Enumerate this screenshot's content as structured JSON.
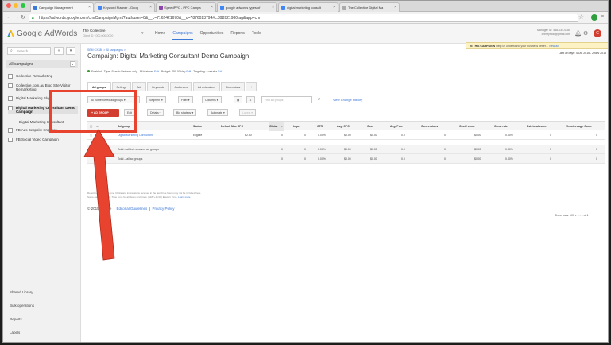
{
  "browser": {
    "tabs": [
      {
        "label": "Campaign Management",
        "color": "#3c78d8"
      },
      {
        "label": "Keyword Planner - Goog",
        "color": "#4285f4"
      },
      {
        "label": "SpeedPPC - PPC Campa",
        "color": "#8e44ad"
      },
      {
        "label": "google adwords types of",
        "color": "#4285f4"
      },
      {
        "label": "digital marketing consult",
        "color": "#4285f4"
      },
      {
        "label": "The Collective Digital Ma",
        "color": "#aaaaaa"
      }
    ],
    "url": "https://adwords.google.com/cm/CampaignMgmt?authuser=0&__c=7162421670&__u=7876023794#c.398921980.ag&app=cm"
  },
  "header": {
    "logo_google": "Google",
    "logo_adwords": "AdWords",
    "account_name": "The Collective",
    "account_id": "Client ID · 000-000-0000",
    "nav": [
      "Home",
      "Campaigns",
      "Opportunities",
      "Reports",
      "Tools"
    ],
    "active_nav": "Campaigns",
    "manager_line1": "Manager ID: 448-034-0380",
    "manager_line2": "chrisfymoo@gmail.com",
    "avatar_letter": "C"
  },
  "sidebar": {
    "search_placeholder": "Search",
    "all_campaigns": "All campaigns",
    "campaigns": [
      "Collective Remarketing",
      "Collective.com.au Blog Site Visitor Remarketing",
      "Digital Marketing Blog",
      "Digital Marketing Consultant Demo Campaign",
      "Digital Marketing Consultant",
      "FB Ads Bespoke Enquirer",
      "FB Social Video Campaign"
    ],
    "bottom_links": [
      "Shared Library",
      "Bulk operations",
      "Reports",
      "Labels"
    ]
  },
  "main": {
    "breadcrumb": "SEM CX380 > All campaigns >",
    "title_prefix": "Campaign:",
    "title": "Digital Marketing Consultant Demo Campaign",
    "notice_bold": "IN THIS CAMPAIGN",
    "notice_text": "Help us understand your business better...",
    "notice_link": "View all",
    "date_range": "Last 30 days: 4 Oct 2015 - 2 Nov 2015",
    "status": "Enabled",
    "type_label": "Type: Search Network only - All features",
    "type_edit": "Edit",
    "budget_label": "Budget: $50.00/day",
    "budget_edit": "Edit",
    "targeting_label": "Targeting: Australia",
    "targeting_edit": "Edit",
    "tabs": [
      "Ad groups",
      "Settings",
      "Ads",
      "Keywords",
      "Audiences",
      "Ad extensions",
      "Dimensions",
      "+"
    ],
    "active_tab": "Ad groups",
    "toolbar": {
      "filter_select": "All but removed ad groups",
      "segment": "Segment",
      "filter": "Filter",
      "columns": "Columns",
      "find_placeholder": "Find ad groups",
      "view_history": "View Change History"
    },
    "toolbar2": {
      "add": "+ AD GROUP",
      "edit": "Edit",
      "details": "Details",
      "bid_strategy": "Bid strategy",
      "automate": "Automate",
      "labels": "Labels"
    },
    "table": {
      "headers": [
        "Ad group",
        "Status",
        "Default Max CPC",
        "Clicks",
        "Impr.",
        "CTR",
        "Avg. CPC",
        "Cost",
        "Avg. Pos.",
        "Conversions",
        "Cost / conv.",
        "Conv. rate",
        "Est. total conv.",
        "View-through Conv."
      ],
      "rows": [
        [
          "Digital Marketing Consultant",
          "Eligible",
          "$2.50",
          "0",
          "0",
          "0.00%",
          "$0.00",
          "$0.00",
          "0.0",
          "0",
          "$0.00",
          "0.00%",
          "0",
          "0"
        ]
      ],
      "totals": [
        [
          "Total – all but removed ad groups",
          "",
          "",
          "0",
          "0",
          "0.00%",
          "$0.00",
          "$0.00",
          "0.0",
          "0",
          "$0.00",
          "0.00%",
          "0",
          "0"
        ],
        [
          "Total – all ad groups",
          "",
          "",
          "0",
          "0",
          "0.00%",
          "$0.00",
          "$0.00",
          "0.0",
          "0",
          "$0.00",
          "0.00%",
          "0",
          "0"
        ]
      ],
      "pagination": "Show rows: 100 ▾   1 - 1 of 1"
    },
    "disclaimer_line1": "Reporting is not real-time. Clicks and impressions received in the last three hours may not be included here.",
    "disclaimer_line2": "Some data is delayed. Time zone for all dates and times: (GMT+11:00) Eastern Time.",
    "disclaimer_link": "Learn more",
    "footer_copyright": "© 2015 Google",
    "footer_links": [
      "Editorial Guidelines",
      "Privacy Policy"
    ]
  },
  "colors": {
    "accent": "#3c78d8",
    "add_button": "#d23f31",
    "annotation": "#e8432f",
    "notice_bg": "#fdf2c4"
  }
}
